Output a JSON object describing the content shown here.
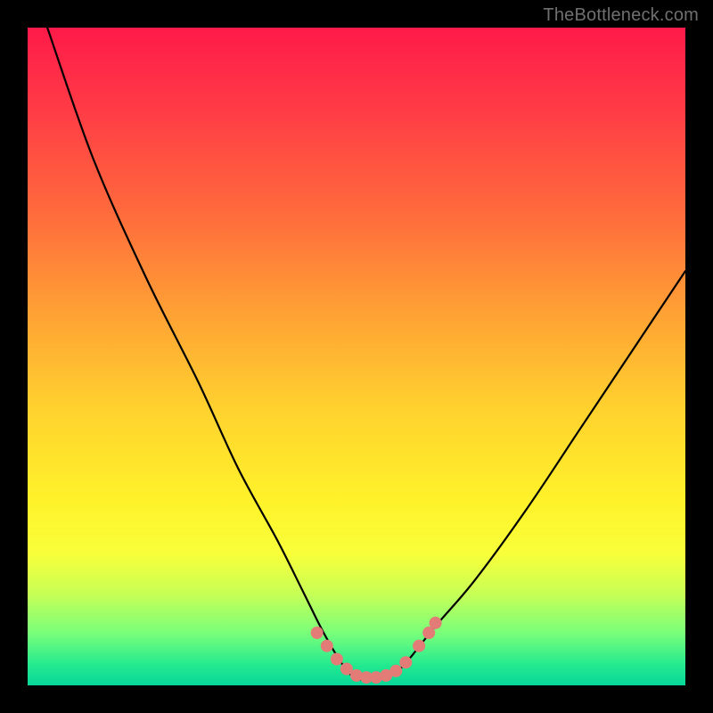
{
  "watermark": "TheBottleneck.com",
  "chart_data": {
    "type": "line",
    "title": "",
    "xlabel": "",
    "ylabel": "",
    "xlim": [
      0,
      100
    ],
    "ylim": [
      0,
      100
    ],
    "grid": false,
    "legend": false,
    "series": [
      {
        "name": "bottleneck-curve",
        "x": [
          3,
          10,
          18,
          26,
          32,
          38,
          42,
          45,
          48,
          50,
          52,
          54,
          56,
          58,
          62,
          68,
          76,
          84,
          92,
          100
        ],
        "y": [
          100,
          80,
          62,
          46,
          33,
          22,
          14,
          8,
          3,
          1,
          1,
          1,
          2,
          4,
          9,
          16,
          27,
          39,
          51,
          63
        ]
      }
    ],
    "markers": {
      "name": "highlight-band",
      "points": [
        {
          "x": 44,
          "y": 8
        },
        {
          "x": 45.5,
          "y": 6
        },
        {
          "x": 47,
          "y": 4
        },
        {
          "x": 48.5,
          "y": 2.5
        },
        {
          "x": 50,
          "y": 1.5
        },
        {
          "x": 51.5,
          "y": 1.2
        },
        {
          "x": 53,
          "y": 1.2
        },
        {
          "x": 54.5,
          "y": 1.5
        },
        {
          "x": 56,
          "y": 2.2
        },
        {
          "x": 57.5,
          "y": 3.5
        },
        {
          "x": 59.5,
          "y": 6
        },
        {
          "x": 61,
          "y": 8
        },
        {
          "x": 62,
          "y": 9.5
        }
      ],
      "color": "#e37b77",
      "radius": 7
    },
    "background_gradient": {
      "top": "#ff1a49",
      "upper_mid": "#ffa334",
      "mid": "#fff22a",
      "lower_mid": "#7aff7a",
      "bottom": "#08d79a"
    }
  }
}
